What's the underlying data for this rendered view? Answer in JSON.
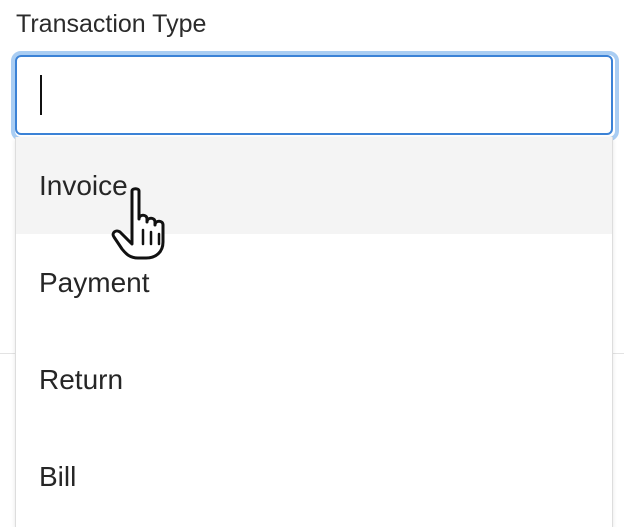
{
  "field": {
    "label": "Transaction Type",
    "value": ""
  },
  "dropdown": {
    "options": [
      {
        "label": "Invoice",
        "hovered": true
      },
      {
        "label": "Payment",
        "hovered": false
      },
      {
        "label": "Return",
        "hovered": false
      },
      {
        "label": "Bill",
        "hovered": false
      }
    ]
  },
  "colors": {
    "focus_border": "#3b82d6",
    "focus_ring": "#a9cdf3",
    "hover_background": "#f4f4f4"
  },
  "cursor": {
    "icon": "hand-pointer-icon"
  }
}
